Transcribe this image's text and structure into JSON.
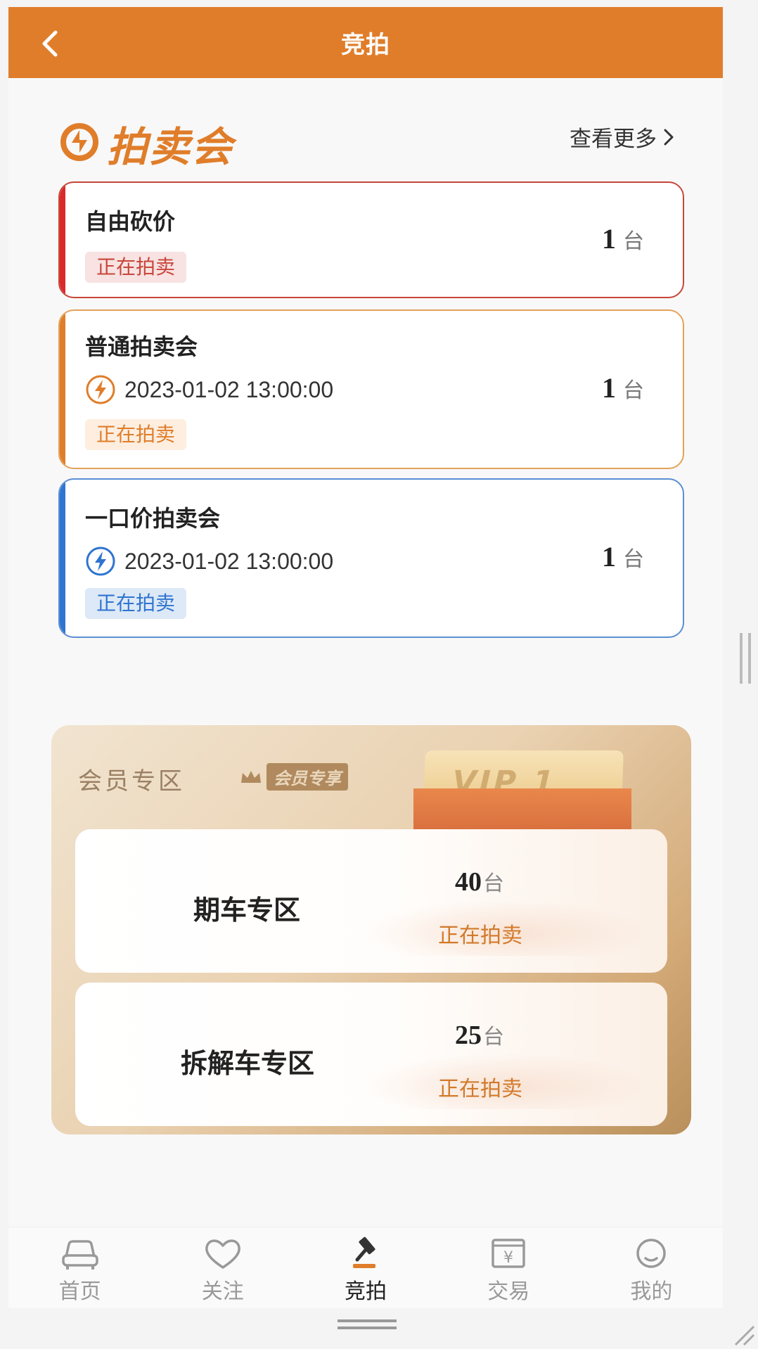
{
  "header": {
    "title": "竞拍"
  },
  "section": {
    "title": "拍卖会",
    "see_more": "查看更多"
  },
  "auctions": [
    {
      "title": "自由砍价",
      "time": "",
      "status": "正在拍卖",
      "count": "1",
      "unit": "台",
      "color": "#d92b2b"
    },
    {
      "title": "普通拍卖会",
      "time": "2023-01-02 13:00:00",
      "status": "正在拍卖",
      "count": "1",
      "unit": "台",
      "color": "#e07d2a"
    },
    {
      "title": "一口价拍卖会",
      "time": "2023-01-02 13:00:00",
      "status": "正在拍卖",
      "count": "1",
      "unit": "台",
      "color": "#2f74d0"
    }
  ],
  "member": {
    "title": "会员专区",
    "badge": "会员专享",
    "vip_label": "VIP 1",
    "zones": [
      {
        "name": "期车专区",
        "count": "40",
        "unit": "台",
        "status": "正在拍卖"
      },
      {
        "name": "拆解车专区",
        "count": "25",
        "unit": "台",
        "status": "正在拍卖"
      }
    ]
  },
  "tabs": [
    {
      "label": "首页",
      "icon": "car-icon",
      "active": false
    },
    {
      "label": "关注",
      "icon": "heart-icon",
      "active": false
    },
    {
      "label": "竞拍",
      "icon": "gavel-icon",
      "active": true
    },
    {
      "label": "交易",
      "icon": "yen-wallet-icon",
      "active": false
    },
    {
      "label": "我的",
      "icon": "profile-icon",
      "active": false
    }
  ],
  "colors": {
    "brand": "#e07d2a",
    "red": "#d92b2b",
    "blue": "#2f74d0"
  }
}
